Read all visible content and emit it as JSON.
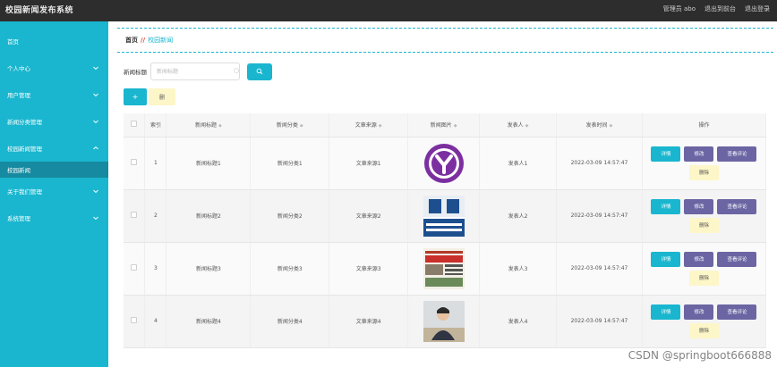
{
  "app": {
    "title": "校园新闻发布系统",
    "top_links": [
      "管理员 abo",
      "退出到前台",
      "退出登录"
    ]
  },
  "sidebar": {
    "items": [
      {
        "label": "首页",
        "has_arrow": false,
        "active": false
      },
      {
        "label": "个人中心",
        "has_arrow": true,
        "active": false
      },
      {
        "label": "用户管理",
        "has_arrow": true,
        "active": false
      },
      {
        "label": "新闻分类管理",
        "has_arrow": true,
        "active": false
      },
      {
        "label": "校园新闻管理",
        "has_arrow": true,
        "active": false
      },
      {
        "label": "校园新闻",
        "has_arrow": false,
        "active": true
      },
      {
        "label": "关于我们管理",
        "has_arrow": true,
        "active": false
      },
      {
        "label": "系统管理",
        "has_arrow": true,
        "active": false
      }
    ]
  },
  "breadcrumb": {
    "home": "首页",
    "separator": "//",
    "current": "校园新闻"
  },
  "search": {
    "label": "新闻标题",
    "placeholder": "新闻标题"
  },
  "actions": {
    "add_label": "+",
    "delete_label": "删"
  },
  "table": {
    "headers": [
      "索引",
      "新闻标题",
      "新闻分类",
      "文章来源",
      "新闻图片",
      "发表人",
      "发表时间",
      "操作"
    ],
    "rows": [
      {
        "index": "1",
        "title": "新闻标题1",
        "category": "新闻分类1",
        "source": "文章来源1",
        "image": "yahoo-logo",
        "author": "发表人1",
        "time": "2022-03-09 14:57:47"
      },
      {
        "index": "2",
        "title": "新闻标题2",
        "category": "新闻分类2",
        "source": "文章来源2",
        "image": "guonei-news",
        "author": "发表人2",
        "time": "2022-03-09 14:57:47"
      },
      {
        "index": "3",
        "title": "新闻标题3",
        "category": "新闻分类3",
        "source": "文章来源3",
        "image": "shishi-news",
        "author": "发表人3",
        "time": "2022-03-09 14:57:47"
      },
      {
        "index": "4",
        "title": "新闻标题4",
        "category": "新闻分类4",
        "source": "文章来源4",
        "image": "person-photo",
        "author": "发表人4",
        "time": "2022-03-09 14:57:47"
      }
    ],
    "op_labels": {
      "view": "详情",
      "edit": "修改",
      "comment": "查看评论",
      "remove": "删除"
    }
  },
  "watermark": "CSDN @springboot666888",
  "colors": {
    "accent": "#1ab6cf",
    "sidebar_active": "#168aa0",
    "topbar": "#2d2d2d",
    "purple": "#6b65a3",
    "yellow": "#fdf6c8"
  }
}
